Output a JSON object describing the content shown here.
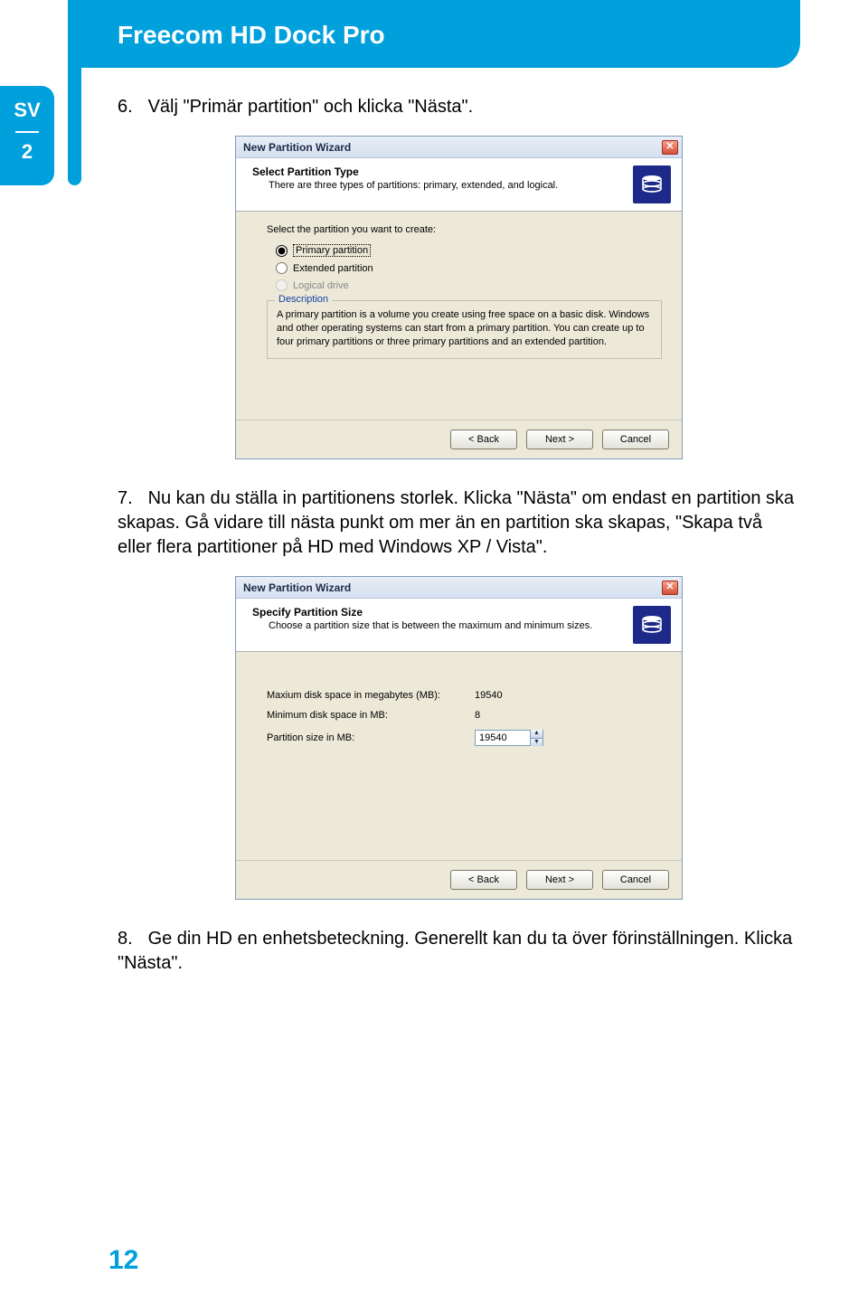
{
  "header": {
    "product_title": "Freecom HD Dock Pro"
  },
  "sidebar": {
    "lang": "SV",
    "chapter": "2"
  },
  "page_number": "12",
  "steps": {
    "s6": {
      "num": "6.",
      "text": "Välj \"Primär partition\" och klicka \"Nästa\"."
    },
    "s7": {
      "num": "7.",
      "text": "Nu kan du ställa in partitionens storlek. Klicka \"Nästa\" om endast en partition ska skapas. Gå vidare till nästa punkt om mer än en partition ska skapas, \"Skapa två eller flera partitioner på HD med Windows XP / Vista\"."
    },
    "s8": {
      "num": "8.",
      "text": "Ge din HD en enhetsbeteckning. Generellt kan du ta över förinställningen. Klicka \"Nästa\"."
    }
  },
  "wiz1": {
    "title": "New Partition Wizard",
    "header_title": "Select Partition Type",
    "header_sub": "There are three types of partitions: primary, extended, and logical.",
    "prompt": "Select the partition you want to create:",
    "opt_primary": "Primary partition",
    "opt_extended": "Extended partition",
    "opt_logical": "Logical drive",
    "desc_legend": "Description",
    "desc_text": "A primary partition is a volume you create using free space on a basic disk. Windows and other operating systems can start from a primary partition. You can create up to four primary partitions or three primary partitions and an extended partition.",
    "btn_back": "< Back",
    "btn_next": "Next >",
    "btn_cancel": "Cancel"
  },
  "wiz2": {
    "title": "New Partition Wizard",
    "header_title": "Specify Partition Size",
    "header_sub": "Choose a partition size that is between the maximum and minimum sizes.",
    "row_max_label": "Maxium disk space in megabytes (MB):",
    "row_max_value": "19540",
    "row_min_label": "Minimum disk space in MB:",
    "row_min_value": "8",
    "row_size_label": "Partition size in MB:",
    "row_size_value": "19540",
    "btn_back": "< Back",
    "btn_next": "Next >",
    "btn_cancel": "Cancel"
  }
}
